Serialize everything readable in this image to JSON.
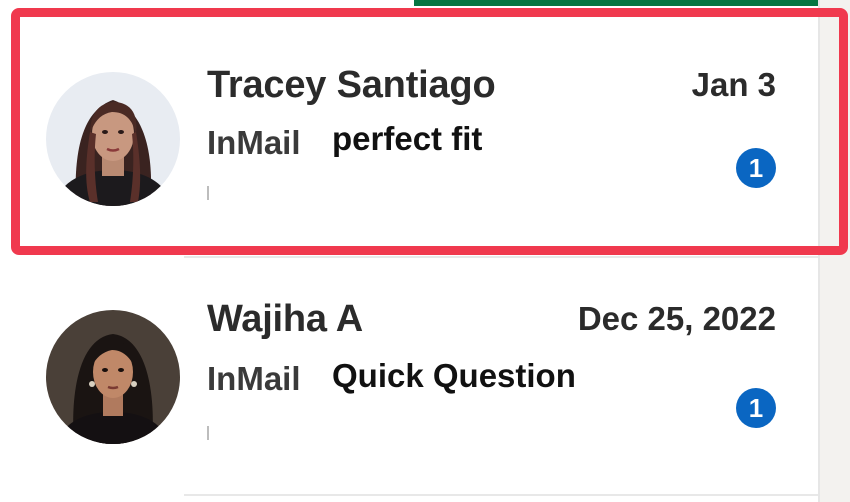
{
  "conversations": [
    {
      "name": "Tracey Santiago",
      "date": "Jan 3",
      "type": "InMail",
      "subject": "perfect fit",
      "unread_count": "1",
      "avatar_icon": "person-photo"
    },
    {
      "name": "Wajiha A",
      "date": "Dec 25, 2022",
      "type": "InMail",
      "subject": "Quick Question",
      "unread_count": "1",
      "avatar_icon": "person-photo"
    }
  ],
  "colors": {
    "highlight": "#f0394e",
    "badge": "#0a66c2",
    "accent": "#057642"
  }
}
